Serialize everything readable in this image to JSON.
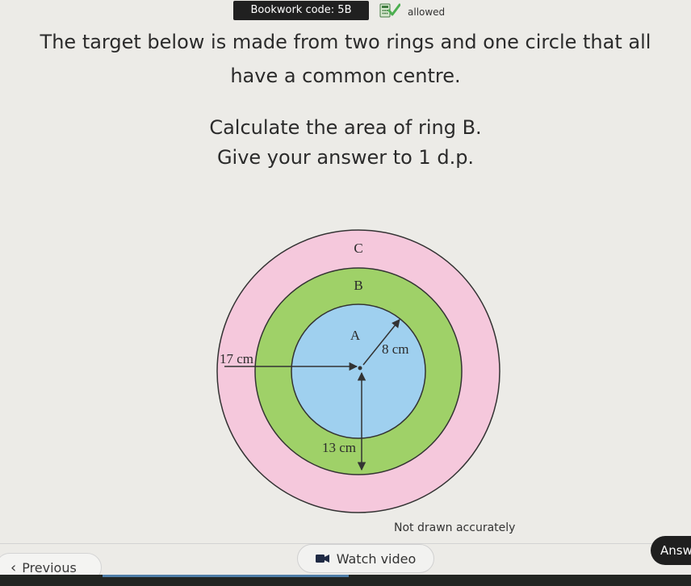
{
  "header": {
    "bookwork_code": "Bookwork code: 5B",
    "calculator_status": "allowed"
  },
  "question": {
    "line1": "The target below is made from two rings and one circle that all",
    "line2": "have a common centre.",
    "line3": "Calculate the area of ring B.",
    "line4": "Give your answer to 1 d.p."
  },
  "diagram": {
    "region_c_label": "C",
    "region_b_label": "B",
    "region_a_label": "A",
    "radius_a_label": "8 cm",
    "radius_b_label": "13 cm",
    "radius_c_label": "17 cm",
    "note": "Not drawn accurately",
    "colors": {
      "ring_c": "#f5c8dc",
      "ring_b": "#9fd168",
      "circle_a": "#9fd0ef",
      "outline": "#333333"
    }
  },
  "footer": {
    "previous_label": "Previous",
    "watch_video_label": "Watch video",
    "answer_label": "Answer"
  }
}
